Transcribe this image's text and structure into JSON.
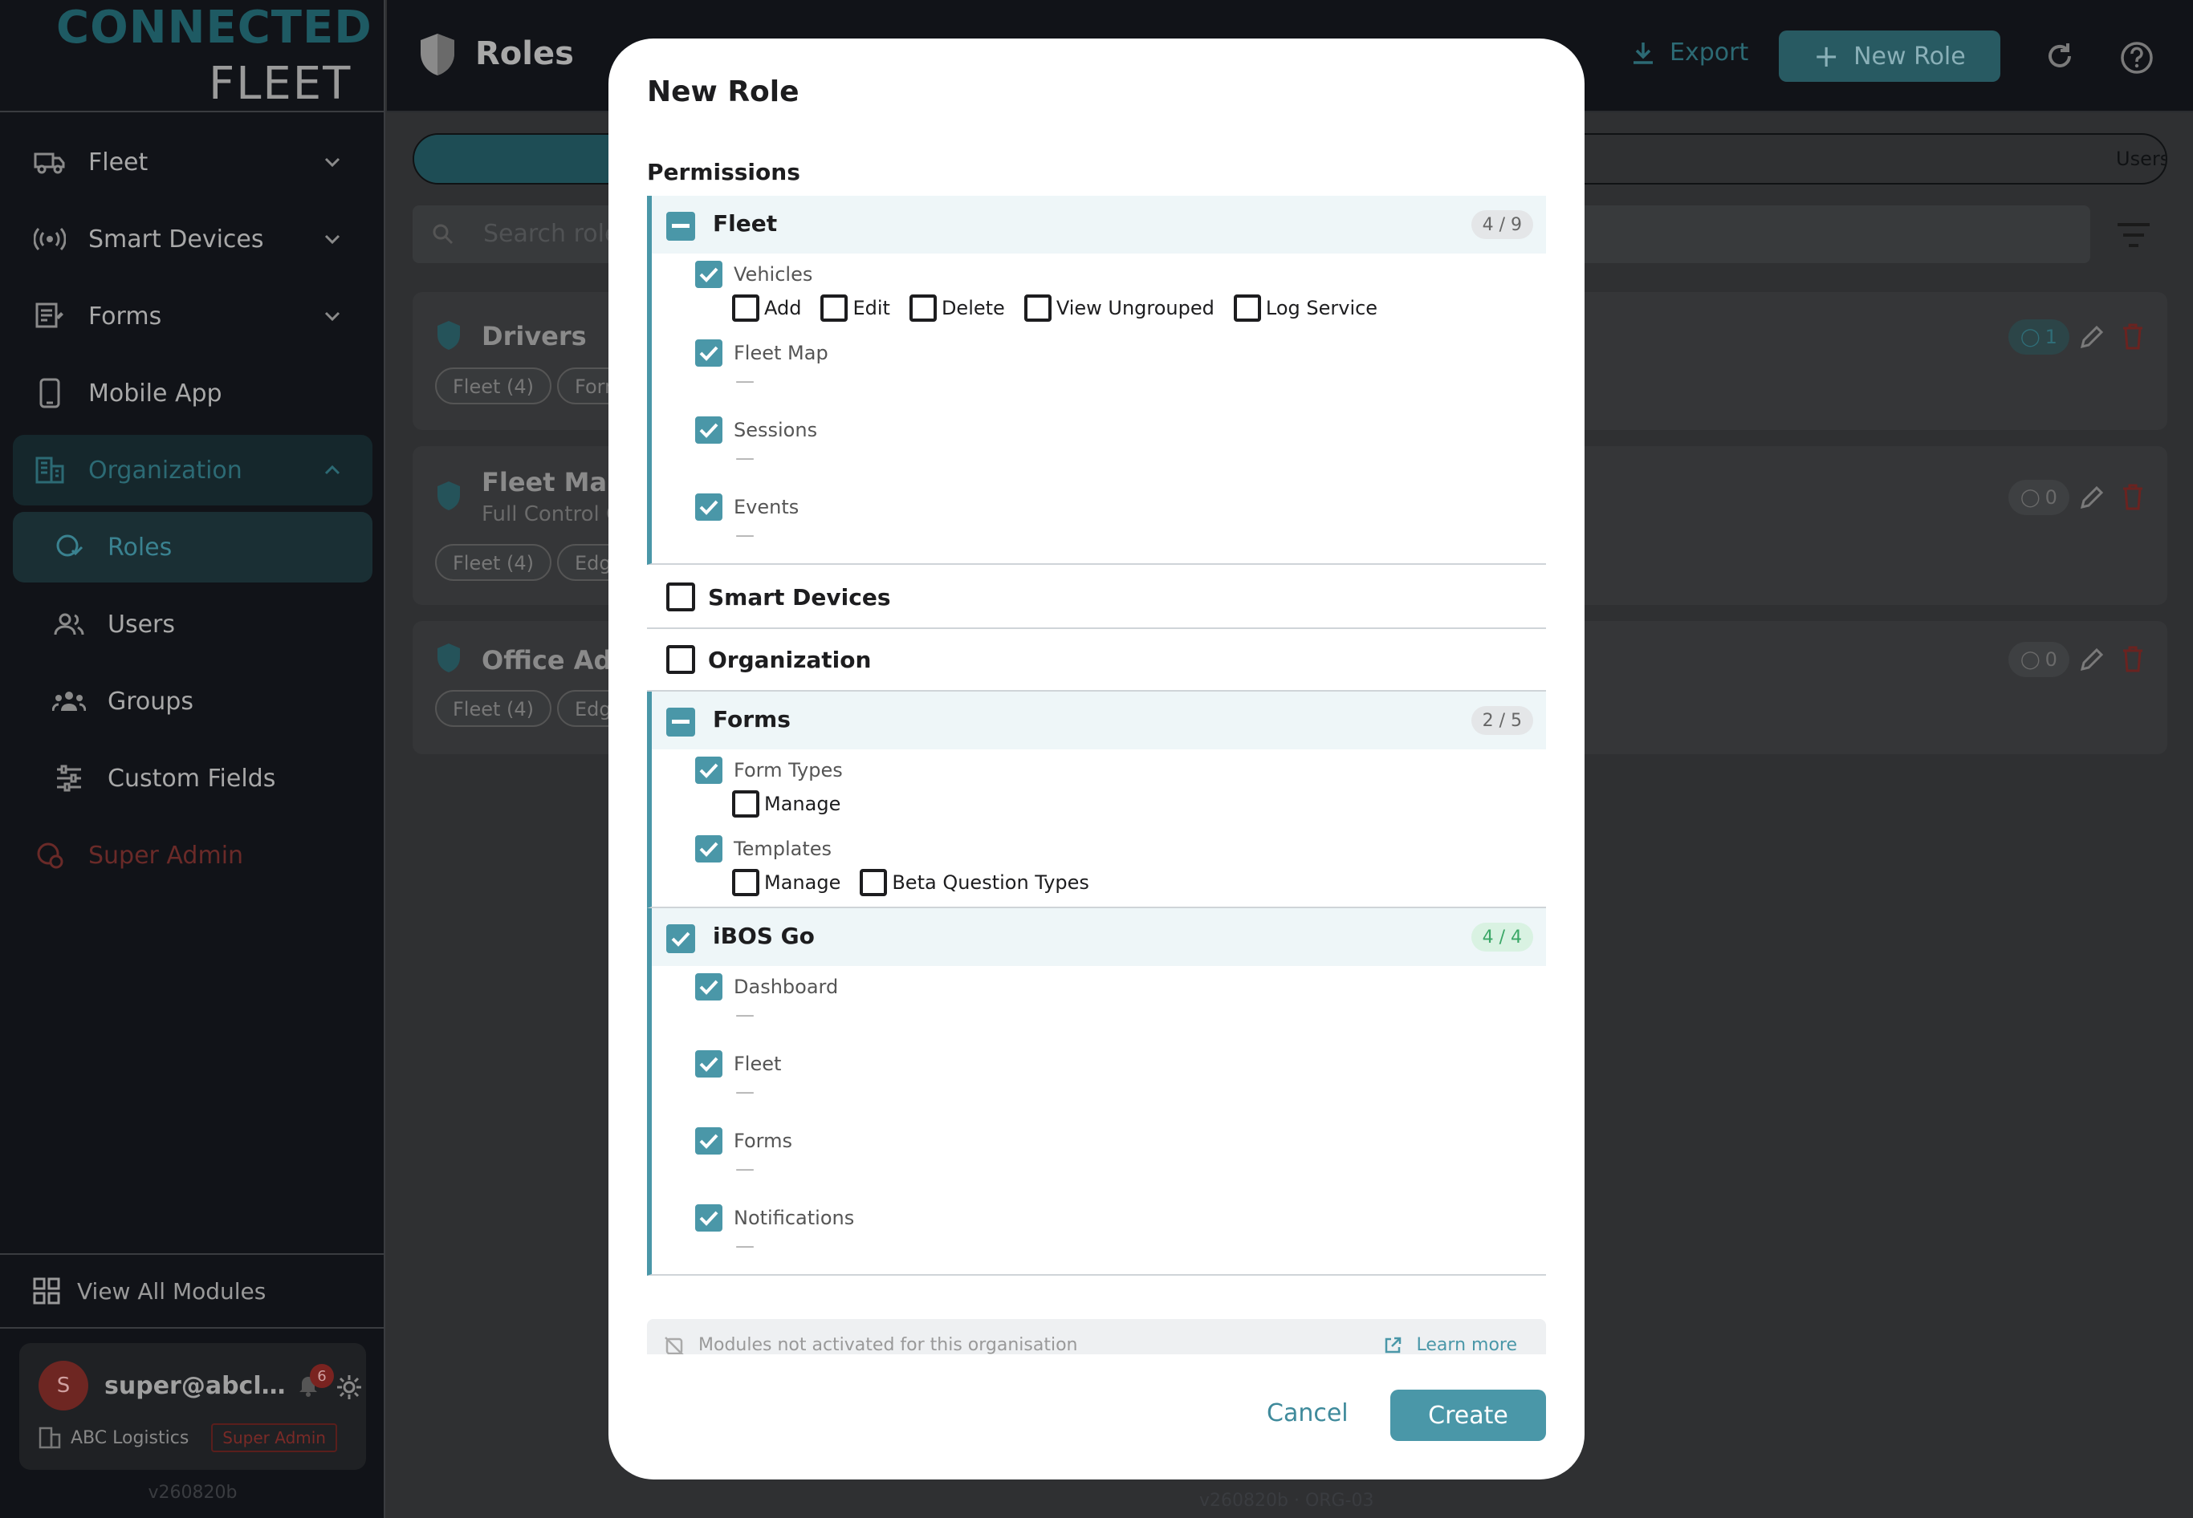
{
  "brand": {
    "line1": "CONNECTED",
    "line2": "FLEET"
  },
  "sidebar": {
    "items": [
      {
        "label": "Fleet",
        "icon": "truck-icon"
      },
      {
        "label": "Smart Devices",
        "icon": "broadcast-icon"
      },
      {
        "label": "Forms",
        "icon": "forms-icon"
      },
      {
        "label": "Mobile App",
        "icon": "phone-icon"
      },
      {
        "label": "Organization",
        "icon": "building-icon"
      }
    ],
    "sub_items": [
      {
        "label": "Roles",
        "icon": "roles-icon"
      },
      {
        "label": "Users",
        "icon": "users-icon"
      },
      {
        "label": "Groups",
        "icon": "groups-icon"
      },
      {
        "label": "Custom Fields",
        "icon": "sliders-icon"
      }
    ],
    "super_admin": "Super Admin",
    "view_all": "View All Modules",
    "user": {
      "initial": "S",
      "email": "super@abclogi...",
      "notifications": "6",
      "org": "ABC Logistics",
      "role_badge": "Super Admin"
    },
    "version": "v260820b"
  },
  "topbar": {
    "title": "Roles",
    "export": "Export",
    "new_role": "New Role"
  },
  "tabs": {
    "users": "Users"
  },
  "search": {
    "placeholder": "Search role"
  },
  "roles": [
    {
      "name": "Drivers",
      "desc": "",
      "chips": [
        "Fleet (4)",
        "Forr"
      ],
      "count": "1"
    },
    {
      "name": "Fleet Mana",
      "desc": "Full Control C",
      "chips": [
        "Fleet (4)",
        "Edg"
      ],
      "count": "0"
    },
    {
      "name": "Office Adm",
      "desc": "",
      "chips": [
        "Fleet (4)",
        "Edg"
      ],
      "count": "0"
    }
  ],
  "main_version": "v260820b · ORG-03",
  "modal": {
    "title": "New Role",
    "permissions_label": "Permissions",
    "groups": {
      "fleet": {
        "name": "Fleet",
        "count": "4 / 9",
        "perms": {
          "vehicles": {
            "name": "Vehicles",
            "actions": [
              "Add",
              "Edit",
              "Delete",
              "View Ungrouped",
              "Log Service"
            ]
          },
          "fleet_map": {
            "name": "Fleet Map",
            "dash": "—"
          },
          "sessions": {
            "name": "Sessions",
            "dash": "—"
          },
          "events": {
            "name": "Events",
            "dash": "—"
          }
        }
      },
      "smart_devices": {
        "name": "Smart Devices"
      },
      "organization": {
        "name": "Organization"
      },
      "forms": {
        "name": "Forms",
        "count": "2 / 5",
        "perms": {
          "form_types": {
            "name": "Form Types",
            "actions": [
              "Manage"
            ]
          },
          "templates": {
            "name": "Templates",
            "actions": [
              "Manage",
              "Beta Question Types"
            ]
          }
        }
      },
      "ibos_go": {
        "name": "iBOS Go",
        "count": "4 / 4",
        "perms": {
          "dashboard": {
            "name": "Dashboard",
            "dash": "—"
          },
          "fleet": {
            "name": "Fleet",
            "dash": "—"
          },
          "forms": {
            "name": "Forms",
            "dash": "—"
          },
          "notifications": {
            "name": "Notifications",
            "dash": "—"
          }
        }
      }
    },
    "modules_note": "Modules not activated for this organisation",
    "learn_more": "Learn more",
    "cancel": "Cancel",
    "create": "Create"
  },
  "colors": {
    "accent": "#4a97a8",
    "success": "#3aa766",
    "danger": "#7a2320"
  }
}
